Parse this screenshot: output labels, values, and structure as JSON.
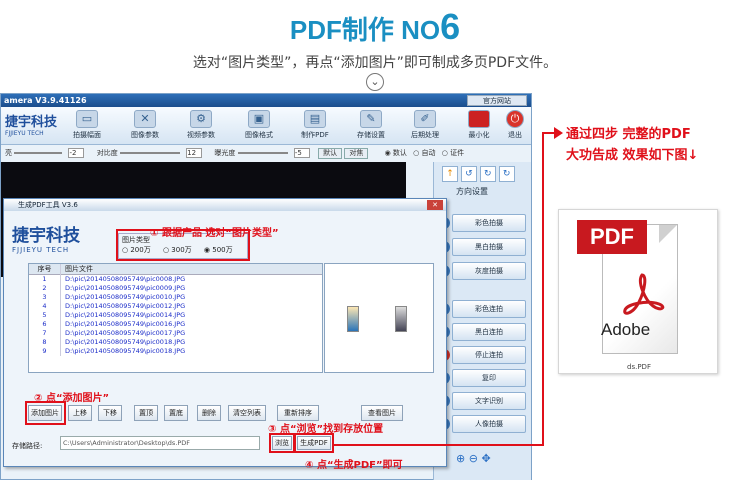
{
  "header": {
    "title_prefix": "PDF制作 NO",
    "title_number": "6",
    "subtitle": "选对“图片类型”，再点“添加图片”即可制成多页PDF文件。"
  },
  "app": {
    "window_title": "amera V3.9.41126",
    "window_btn": "官方网站",
    "logo_cn": "捷宇科技",
    "logo_en": "FJJIEYU TECH",
    "toolbar": [
      "拍摄幅面",
      "图像参数",
      "视频参数",
      "图像格式",
      "制作PDF",
      "存储设置",
      "后期处理",
      "最小化",
      "退出"
    ],
    "sliders": {
      "brightness": "亮",
      "contrast_label": "对比度",
      "exposure_label": "曝光度",
      "default_btn": "默认",
      "focus_btn": "对焦",
      "v1": "-2",
      "v2": "12",
      "v3": "-5"
    },
    "mode": {
      "default": "数认",
      "auto": "自动",
      "cert": "证件"
    },
    "direction_label": "方向设置",
    "right_buttons": [
      "彩色拍摄",
      "黑白拍摄",
      "灰度拍摄",
      "彩色连拍",
      "黑白连拍",
      "停止连拍",
      "复印",
      "文字识别",
      "人像拍摄"
    ]
  },
  "dialog": {
    "title": "生成PDF工具 V3.6",
    "logo_cn": "捷宇科技",
    "logo_en": "FJJIEYU TECH",
    "ptype_label": "图片类型",
    "ptype_options": [
      "200万",
      "300万",
      "500万"
    ],
    "columns": [
      "序号",
      "图片文件"
    ],
    "rows": [
      {
        "n": "1",
        "file": "D:\\pic\\20140508095749\\pic0008.JPG"
      },
      {
        "n": "2",
        "file": "D:\\pic\\20140508095749\\pic0009.JPG"
      },
      {
        "n": "3",
        "file": "D:\\pic\\20140508095749\\pic0010.JPG"
      },
      {
        "n": "4",
        "file": "D:\\pic\\20140508095749\\pic0012.JPG"
      },
      {
        "n": "5",
        "file": "D:\\pic\\20140508095749\\pic0014.JPG"
      },
      {
        "n": "6",
        "file": "D:\\pic\\20140508095749\\pic0016.JPG"
      },
      {
        "n": "7",
        "file": "D:\\pic\\20140508095749\\pic0017.JPG"
      },
      {
        "n": "8",
        "file": "D:\\pic\\20140508095749\\pic0018.JPG"
      },
      {
        "n": "9",
        "file": "D:\\pic\\20140508095749\\pic0018.JPG"
      }
    ],
    "buttons": [
      "添加图片",
      "上移",
      "下移",
      "置顶",
      "置底",
      "删除",
      "清空列表",
      "重新排序",
      "查看图片"
    ],
    "path_label": "存储路径:",
    "path_value": "C:\\Users\\Administrator\\Desktop\\ds.PDF",
    "browse_btn": "浏览",
    "generate_btn": "生成PDF"
  },
  "annotations": {
    "a1": "① 跟据产品  选对“图片类型”",
    "a2": "② 点“添加图片”",
    "a3": "③ 点“浏览”找到存放位置",
    "a4": "④ 点“生成PDF”即可"
  },
  "result": {
    "line1": "通过四步  完整的PDF",
    "line2": "大功告成  效果如下图↓",
    "pdf_label": "PDF",
    "adobe_label": "Adobe",
    "file_name": "ds.PDF"
  },
  "colors": {
    "accent": "#1a8fc2",
    "annotation": "#e0101a",
    "pdf_red": "#c8191f"
  }
}
